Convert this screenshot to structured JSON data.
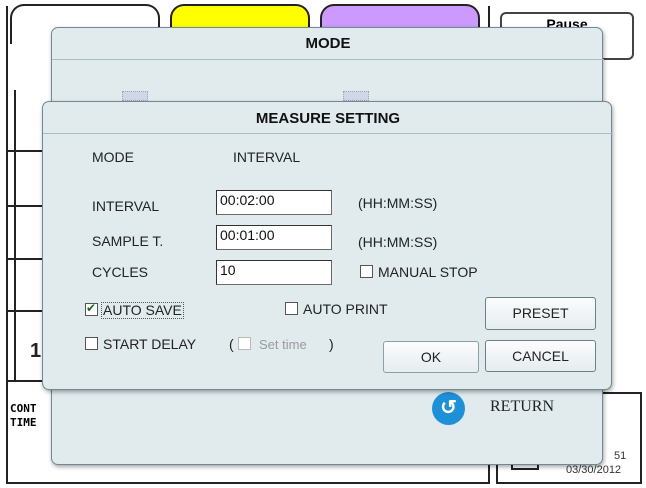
{
  "mode_dialog": {
    "title": "MODE",
    "return_label": "RETURN"
  },
  "measure_dialog": {
    "title": "MEASURE SETTING",
    "mode_label": "MODE",
    "mode_value": "INTERVAL",
    "interval": {
      "label": "INTERVAL",
      "value": "00:02:00",
      "unit": "(HH:MM:SS)"
    },
    "sample": {
      "label": "SAMPLE T.",
      "value": "00:01:00",
      "unit": "(HH:MM:SS)"
    },
    "cycles": {
      "label": "CYCLES",
      "value": "10"
    },
    "manual_stop": {
      "label": "MANUAL STOP",
      "checked": false
    },
    "auto_save": {
      "label": "AUTO SAVE",
      "checked": true
    },
    "auto_print": {
      "label": "AUTO PRINT",
      "checked": false
    },
    "start_delay": {
      "label": "START DELAY",
      "checked": false
    },
    "set_time": {
      "open": "(",
      "label": "Set time",
      "close": ")",
      "checked": false
    },
    "buttons": {
      "preset": "PRESET",
      "ok": "OK",
      "cancel": "CANCEL"
    }
  },
  "background": {
    "pause_label": "Pause",
    "left_digit": "1",
    "cont_label": "CONT",
    "time_label": "TIME",
    "counter_fragment": "51",
    "date": "03/30/2012"
  },
  "colors": {
    "tab_yellow": "#ffff00",
    "tab_purple": "#cc99ff",
    "dialog_bg": "#e1ebed",
    "return_icon": "#1e90d8"
  }
}
